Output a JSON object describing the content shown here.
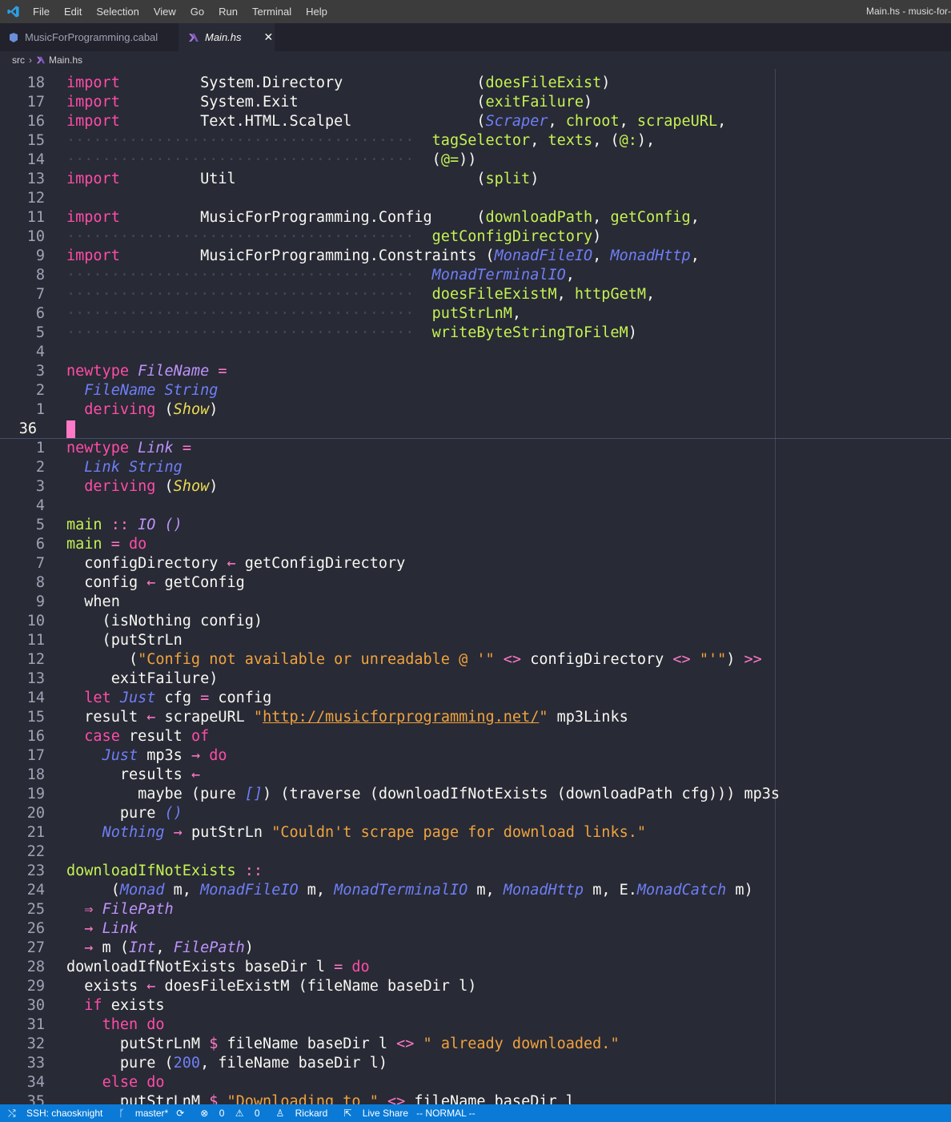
{
  "titlebar": {
    "menu": [
      "File",
      "Edit",
      "Selection",
      "View",
      "Go",
      "Run",
      "Terminal",
      "Help"
    ],
    "window_title": "Main.hs - music-for-"
  },
  "tabs": [
    {
      "label": "MusicForProgramming.cabal"
    },
    {
      "label": "Main.hs",
      "close": "✕"
    }
  ],
  "breadcrumb": {
    "folder": "src",
    "file": "Main.hs"
  },
  "editor": {
    "cursor_line_number": "36",
    "top_lines": [
      {
        "ln": "18",
        "segs": [
          [
            "im",
            "import"
          ],
          [
            "p",
            "         System.Directory               "
          ],
          [
            "p",
            "("
          ],
          [
            "fn",
            "doesFileExist"
          ],
          [
            "p",
            ")"
          ]
        ]
      },
      {
        "ln": "17",
        "segs": [
          [
            "im",
            "import"
          ],
          [
            "p",
            "         System.Exit                    "
          ],
          [
            "p",
            "("
          ],
          [
            "fn",
            "exitFailure"
          ],
          [
            "p",
            ")"
          ]
        ]
      },
      {
        "ln": "16",
        "segs": [
          [
            "im",
            "import"
          ],
          [
            "p",
            "         Text.HTML.Scalpel              "
          ],
          [
            "p",
            "("
          ],
          [
            "blue",
            "Scraper"
          ],
          [
            "p",
            ", "
          ],
          [
            "fn",
            "chroot"
          ],
          [
            "p",
            ", "
          ],
          [
            "fn",
            "scrapeURL"
          ],
          [
            "p",
            ","
          ]
        ]
      },
      {
        "ln": "15",
        "segs": [
          [
            "dots",
            "·······································"
          ],
          [
            "p",
            "  "
          ],
          [
            "fn",
            "tagSelector"
          ],
          [
            "p",
            ", "
          ],
          [
            "fn",
            "texts"
          ],
          [
            "p",
            ", ("
          ],
          [
            "fn",
            "@:"
          ],
          [
            "p",
            "),"
          ]
        ]
      },
      {
        "ln": "14",
        "segs": [
          [
            "dots",
            "·······································"
          ],
          [
            "p",
            "  ("
          ],
          [
            "fn",
            "@="
          ],
          [
            "p",
            "))"
          ]
        ]
      },
      {
        "ln": "13",
        "segs": [
          [
            "im",
            "import"
          ],
          [
            "p",
            "         Util                           "
          ],
          [
            "p",
            "("
          ],
          [
            "fn",
            "split"
          ],
          [
            "p",
            ")"
          ]
        ]
      },
      {
        "ln": "12",
        "segs": []
      },
      {
        "ln": "11",
        "segs": [
          [
            "im",
            "import"
          ],
          [
            "p",
            "         MusicForProgramming.Config     "
          ],
          [
            "p",
            "("
          ],
          [
            "fn",
            "downloadPath"
          ],
          [
            "p",
            ", "
          ],
          [
            "fn",
            "getConfig"
          ],
          [
            "p",
            ","
          ]
        ]
      },
      {
        "ln": "10",
        "segs": [
          [
            "dots",
            "·······································"
          ],
          [
            "p",
            "  "
          ],
          [
            "fn",
            "getConfigDirectory"
          ],
          [
            "p",
            ")"
          ]
        ]
      },
      {
        "ln": "9",
        "segs": [
          [
            "im",
            "import"
          ],
          [
            "p",
            "         MusicForProgramming.Constraints "
          ],
          [
            "p",
            "("
          ],
          [
            "blue",
            "MonadFileIO"
          ],
          [
            "p",
            ", "
          ],
          [
            "blue",
            "MonadHttp"
          ],
          [
            "p",
            ","
          ]
        ]
      },
      {
        "ln": "8",
        "segs": [
          [
            "dots",
            "·······································"
          ],
          [
            "p",
            "  "
          ],
          [
            "blue",
            "MonadTerminalIO"
          ],
          [
            "p",
            ","
          ]
        ]
      },
      {
        "ln": "7",
        "segs": [
          [
            "dots",
            "·······································"
          ],
          [
            "p",
            "  "
          ],
          [
            "fn",
            "doesFileExistM"
          ],
          [
            "p",
            ", "
          ],
          [
            "fn",
            "httpGetM"
          ],
          [
            "p",
            ","
          ]
        ]
      },
      {
        "ln": "6",
        "segs": [
          [
            "dots",
            "·······································"
          ],
          [
            "p",
            "  "
          ],
          [
            "fn",
            "putStrLnM"
          ],
          [
            "p",
            ","
          ]
        ]
      },
      {
        "ln": "5",
        "segs": [
          [
            "dots",
            "·······································"
          ],
          [
            "p",
            "  "
          ],
          [
            "fn",
            "writeByteStringToFileM"
          ],
          [
            "p",
            ")"
          ]
        ]
      },
      {
        "ln": "4",
        "segs": []
      },
      {
        "ln": "3",
        "segs": [
          [
            "im",
            "newtype"
          ],
          [
            "p",
            " "
          ],
          [
            "t",
            "FileName"
          ],
          [
            "p",
            " "
          ],
          [
            "o",
            "="
          ]
        ]
      },
      {
        "ln": "2",
        "segs": [
          [
            "p",
            "  "
          ],
          [
            "blue",
            "FileName"
          ],
          [
            "p",
            " "
          ],
          [
            "blue",
            "String"
          ]
        ]
      },
      {
        "ln": "1",
        "segs": [
          [
            "p",
            "  "
          ],
          [
            "im",
            "deriving"
          ],
          [
            "p",
            " ("
          ],
          [
            "cy",
            "Show"
          ],
          [
            "p",
            ")"
          ]
        ]
      }
    ],
    "bottom_lines": [
      {
        "ln": "1",
        "segs": [
          [
            "im",
            "newtype"
          ],
          [
            "p",
            " "
          ],
          [
            "t",
            "Link"
          ],
          [
            "p",
            " "
          ],
          [
            "o",
            "="
          ]
        ]
      },
      {
        "ln": "2",
        "segs": [
          [
            "p",
            "  "
          ],
          [
            "blue",
            "Link"
          ],
          [
            "p",
            " "
          ],
          [
            "blue",
            "String"
          ]
        ]
      },
      {
        "ln": "3",
        "segs": [
          [
            "p",
            "  "
          ],
          [
            "im",
            "deriving"
          ],
          [
            "p",
            " ("
          ],
          [
            "cy",
            "Show"
          ],
          [
            "p",
            ")"
          ]
        ]
      },
      {
        "ln": "4",
        "segs": []
      },
      {
        "ln": "5",
        "segs": [
          [
            "fn",
            "main"
          ],
          [
            "p",
            " "
          ],
          [
            "o",
            "::"
          ],
          [
            "p",
            " "
          ],
          [
            "t",
            "IO"
          ],
          [
            "p",
            " "
          ],
          [
            "t",
            "()"
          ]
        ]
      },
      {
        "ln": "6",
        "segs": [
          [
            "fn",
            "main"
          ],
          [
            "p",
            " "
          ],
          [
            "o",
            "="
          ],
          [
            "p",
            " "
          ],
          [
            "im",
            "do"
          ]
        ]
      },
      {
        "ln": "7",
        "segs": [
          [
            "p",
            "  configDirectory "
          ],
          [
            "o",
            "←"
          ],
          [
            "p",
            " getConfigDirectory"
          ]
        ]
      },
      {
        "ln": "8",
        "segs": [
          [
            "p",
            "  config "
          ],
          [
            "o",
            "←"
          ],
          [
            "p",
            " getConfig"
          ]
        ]
      },
      {
        "ln": "9",
        "segs": [
          [
            "p",
            "  when"
          ]
        ]
      },
      {
        "ln": "10",
        "segs": [
          [
            "p",
            "    (isNothing config)"
          ]
        ]
      },
      {
        "ln": "11",
        "segs": [
          [
            "p",
            "    (putStrLn"
          ]
        ]
      },
      {
        "ln": "12",
        "segs": [
          [
            "p",
            "       ("
          ],
          [
            "str",
            "\"Config not available or unreadable @ '\""
          ],
          [
            "p",
            " "
          ],
          [
            "o",
            "<>"
          ],
          [
            "p",
            " configDirectory "
          ],
          [
            "o",
            "<>"
          ],
          [
            "p",
            " "
          ],
          [
            "str",
            "\"'\""
          ],
          [
            "p",
            ") "
          ],
          [
            "o",
            ">>"
          ]
        ]
      },
      {
        "ln": "13",
        "segs": [
          [
            "p",
            "     exitFailure)"
          ]
        ]
      },
      {
        "ln": "14",
        "segs": [
          [
            "p",
            "  "
          ],
          [
            "im",
            "let"
          ],
          [
            "p",
            " "
          ],
          [
            "blue",
            "Just"
          ],
          [
            "p",
            " cfg "
          ],
          [
            "o",
            "="
          ],
          [
            "p",
            " config"
          ]
        ]
      },
      {
        "ln": "15",
        "segs": [
          [
            "p",
            "  result "
          ],
          [
            "o",
            "←"
          ],
          [
            "p",
            " scrapeURL "
          ],
          [
            "str",
            "\""
          ],
          [
            "url",
            "http://musicforprogramming.net/"
          ],
          [
            "str",
            "\""
          ],
          [
            "p",
            " mp3Links"
          ]
        ]
      },
      {
        "ln": "16",
        "segs": [
          [
            "p",
            "  "
          ],
          [
            "im",
            "case"
          ],
          [
            "p",
            " result "
          ],
          [
            "im",
            "of"
          ]
        ]
      },
      {
        "ln": "17",
        "segs": [
          [
            "p",
            "    "
          ],
          [
            "blue",
            "Just"
          ],
          [
            "p",
            " mp3s "
          ],
          [
            "o",
            "→"
          ],
          [
            "p",
            " "
          ],
          [
            "im",
            "do"
          ]
        ]
      },
      {
        "ln": "18",
        "segs": [
          [
            "p",
            "      results "
          ],
          [
            "o",
            "←"
          ]
        ]
      },
      {
        "ln": "19",
        "segs": [
          [
            "p",
            "        maybe (pure "
          ],
          [
            "blue",
            "[]"
          ],
          [
            "p",
            ") (traverse (downloadIfNotExists (downloadPath cfg))) mp3s"
          ]
        ]
      },
      {
        "ln": "20",
        "segs": [
          [
            "p",
            "      pure "
          ],
          [
            "blue",
            "()"
          ]
        ]
      },
      {
        "ln": "21",
        "segs": [
          [
            "p",
            "    "
          ],
          [
            "blue",
            "Nothing"
          ],
          [
            "p",
            " "
          ],
          [
            "o",
            "→"
          ],
          [
            "p",
            " putStrLn "
          ],
          [
            "str",
            "\"Couldn't scrape page for download links.\""
          ]
        ]
      },
      {
        "ln": "22",
        "segs": []
      },
      {
        "ln": "23",
        "segs": [
          [
            "fn",
            "downloadIfNotExists"
          ],
          [
            "p",
            " "
          ],
          [
            "o",
            "::"
          ]
        ]
      },
      {
        "ln": "24",
        "segs": [
          [
            "p",
            "     ("
          ],
          [
            "blue",
            "Monad"
          ],
          [
            "p",
            " m, "
          ],
          [
            "blue",
            "MonadFileIO"
          ],
          [
            "p",
            " m, "
          ],
          [
            "blue",
            "MonadTerminalIO"
          ],
          [
            "p",
            " m, "
          ],
          [
            "blue",
            "MonadHttp"
          ],
          [
            "p",
            " m, E."
          ],
          [
            "blue",
            "MonadCatch"
          ],
          [
            "p",
            " m)"
          ]
        ]
      },
      {
        "ln": "25",
        "segs": [
          [
            "p",
            "  "
          ],
          [
            "o",
            "⇒"
          ],
          [
            "p",
            " "
          ],
          [
            "t",
            "FilePath"
          ]
        ]
      },
      {
        "ln": "26",
        "segs": [
          [
            "p",
            "  "
          ],
          [
            "o",
            "→"
          ],
          [
            "p",
            " "
          ],
          [
            "t",
            "Link"
          ]
        ]
      },
      {
        "ln": "27",
        "segs": [
          [
            "p",
            "  "
          ],
          [
            "o",
            "→"
          ],
          [
            "p",
            " m ("
          ],
          [
            "t",
            "Int"
          ],
          [
            "p",
            ", "
          ],
          [
            "t",
            "FilePath"
          ],
          [
            "p",
            ")"
          ]
        ]
      },
      {
        "ln": "28",
        "segs": [
          [
            "p",
            "downloadIfNotExists baseDir l "
          ],
          [
            "o",
            "="
          ],
          [
            "p",
            " "
          ],
          [
            "im",
            "do"
          ]
        ]
      },
      {
        "ln": "29",
        "segs": [
          [
            "p",
            "  exists "
          ],
          [
            "o",
            "←"
          ],
          [
            "p",
            " doesFileExistM (fileName baseDir l)"
          ]
        ]
      },
      {
        "ln": "30",
        "segs": [
          [
            "p",
            "  "
          ],
          [
            "im",
            "if"
          ],
          [
            "p",
            " exists"
          ]
        ]
      },
      {
        "ln": "31",
        "segs": [
          [
            "p",
            "    "
          ],
          [
            "im",
            "then"
          ],
          [
            "p",
            " "
          ],
          [
            "im",
            "do"
          ]
        ]
      },
      {
        "ln": "32",
        "segs": [
          [
            "p",
            "      putStrLnM "
          ],
          [
            "o",
            "$"
          ],
          [
            "p",
            " fileName baseDir l "
          ],
          [
            "o",
            "<>"
          ],
          [
            "p",
            " "
          ],
          [
            "str",
            "\" already downloaded.\""
          ]
        ]
      },
      {
        "ln": "33",
        "segs": [
          [
            "p",
            "      pure ("
          ],
          [
            "num",
            "200"
          ],
          [
            "p",
            ", fileName baseDir l)"
          ]
        ]
      },
      {
        "ln": "34",
        "segs": [
          [
            "p",
            "    "
          ],
          [
            "im",
            "else"
          ],
          [
            "p",
            " "
          ],
          [
            "im",
            "do"
          ]
        ]
      },
      {
        "ln": "35",
        "segs": [
          [
            "p",
            "      putStrLnM "
          ],
          [
            "o",
            "$"
          ],
          [
            "p",
            " "
          ],
          [
            "str",
            "\"Downloading to \""
          ],
          [
            "p",
            " "
          ],
          [
            "o",
            "<>"
          ],
          [
            "p",
            " fileName baseDir l"
          ]
        ]
      }
    ]
  },
  "statusbar": {
    "remote": "SSH: chaosknight",
    "branch": "master*",
    "sync": "⟳",
    "errors": "0",
    "warnings": "0",
    "user": "Rickard",
    "live_share": "Live Share",
    "mode": "-- NORMAL --"
  }
}
